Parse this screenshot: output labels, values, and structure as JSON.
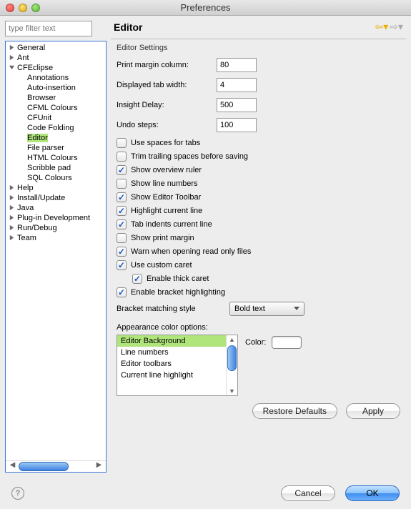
{
  "window": {
    "title": "Preferences"
  },
  "sidebar": {
    "filter_placeholder": "type filter text",
    "items": [
      {
        "label": "General",
        "expanded": false,
        "hasChildren": true
      },
      {
        "label": "Ant",
        "expanded": false,
        "hasChildren": true
      },
      {
        "label": "CFEclipse",
        "expanded": true,
        "hasChildren": true,
        "children": [
          {
            "label": "Annotations"
          },
          {
            "label": "Auto-insertion"
          },
          {
            "label": "Browser"
          },
          {
            "label": "CFML Colours"
          },
          {
            "label": "CFUnit"
          },
          {
            "label": "Code Folding"
          },
          {
            "label": "Editor",
            "selected": true
          },
          {
            "label": "File parser"
          },
          {
            "label": "HTML Colours"
          },
          {
            "label": "Scribble pad"
          },
          {
            "label": "SQL Colours"
          }
        ]
      },
      {
        "label": "Help",
        "expanded": false,
        "hasChildren": true
      },
      {
        "label": "Install/Update",
        "expanded": false,
        "hasChildren": true
      },
      {
        "label": "Java",
        "expanded": false,
        "hasChildren": true
      },
      {
        "label": "Plug-in Development",
        "expanded": false,
        "hasChildren": true
      },
      {
        "label": "Run/Debug",
        "expanded": false,
        "hasChildren": true
      },
      {
        "label": "Team",
        "expanded": false,
        "hasChildren": true
      }
    ]
  },
  "page": {
    "title": "Editor",
    "section": "Editor Settings",
    "fields": {
      "print_margin_label": "Print margin column:",
      "print_margin_value": "80",
      "tab_width_label": "Displayed tab width:",
      "tab_width_value": "4",
      "insight_delay_label": "Insight Delay:",
      "insight_delay_value": "500",
      "undo_steps_label": "Undo steps:",
      "undo_steps_value": "100"
    },
    "checks": [
      {
        "label": "Use spaces for tabs",
        "checked": false
      },
      {
        "label": "Trim trailing spaces before saving",
        "checked": false
      },
      {
        "label": "Show overview ruler",
        "checked": true
      },
      {
        "label": "Show line numbers",
        "checked": false
      },
      {
        "label": "Show Editor Toolbar",
        "checked": true
      },
      {
        "label": "Highlight current line",
        "checked": true
      },
      {
        "label": "Tab indents current line",
        "checked": true
      },
      {
        "label": "Show print margin",
        "checked": false
      },
      {
        "label": "Warn when opening read only files",
        "checked": true
      },
      {
        "label": "Use custom caret",
        "checked": true
      },
      {
        "label": "Enable thick caret",
        "checked": true,
        "indent": true
      },
      {
        "label": "Enable bracket highlighting",
        "checked": true
      }
    ],
    "bracket_style_label": "Bracket matching style",
    "bracket_style_value": "Bold text",
    "appearance_label": "Appearance color options:",
    "color_options": [
      {
        "label": "Editor Background",
        "selected": true
      },
      {
        "label": "Line numbers"
      },
      {
        "label": "Editor toolbars"
      },
      {
        "label": "Current line highlight"
      }
    ],
    "color_label": "Color:",
    "restore_label": "Restore Defaults",
    "apply_label": "Apply"
  },
  "dialog": {
    "cancel": "Cancel",
    "ok": "OK"
  }
}
